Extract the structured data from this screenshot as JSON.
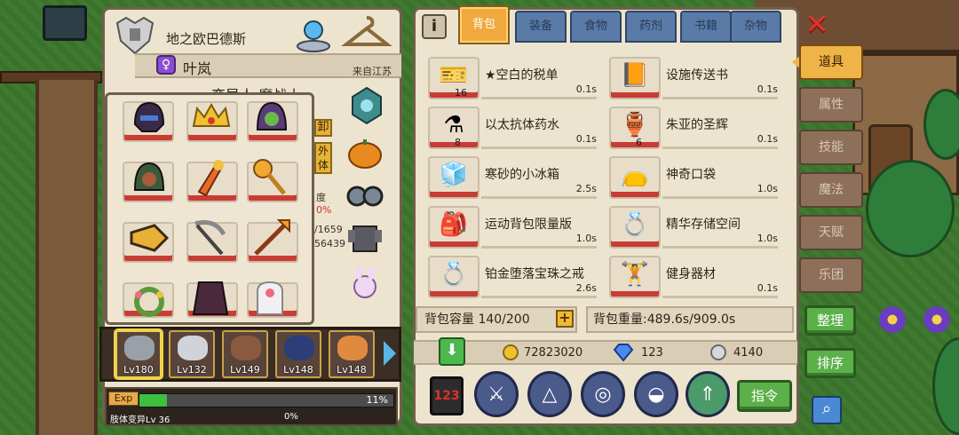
{
  "character": {
    "name": "地之欧巴德斯",
    "player_name": "叶岚",
    "origin": "来自江苏",
    "race": "变异人 魔战士",
    "side_values": [
      "度",
      "0%",
      "/1659",
      "56439"
    ],
    "side_buttons": [
      "卸",
      "外\n体"
    ]
  },
  "heroes": [
    {
      "level": "Lv180",
      "color": "#9aa0a8"
    },
    {
      "level": "Lv132",
      "color": "#d0d4da"
    },
    {
      "level": "Lv149",
      "color": "#8a5a40"
    },
    {
      "level": "Lv148",
      "color": "#2c3e78"
    },
    {
      "level": "Lv148",
      "color": "#e08a40"
    }
  ],
  "exp": {
    "label": "Exp",
    "percent_text": "11%",
    "percent": 11,
    "sub_label": "肢体变异Lv 36",
    "sub_percent_text": "0%"
  },
  "tabs": [
    "背包",
    "装备",
    "食物",
    "药剂",
    "书籍",
    "杂物"
  ],
  "active_tab": 0,
  "items": [
    {
      "name": "★空白的税单",
      "weight": "0.1s",
      "qty": "16",
      "icon": "ticket-icon",
      "glyph": "🎫"
    },
    {
      "name": "设施传送书",
      "weight": "0.1s",
      "qty": "",
      "icon": "book-icon",
      "glyph": "📙"
    },
    {
      "name": "以太抗体药水",
      "weight": "0.1s",
      "qty": "8",
      "icon": "potion-icon",
      "glyph": "⚗"
    },
    {
      "name": "朱亚的圣辉",
      "weight": "0.1s",
      "qty": "6",
      "icon": "holy-flask-icon",
      "glyph": "🏺"
    },
    {
      "name": "寒砂的小冰箱",
      "weight": "2.5s",
      "qty": "",
      "icon": "ice-box-icon",
      "glyph": "🧊"
    },
    {
      "name": "神奇口袋",
      "weight": "1.0s",
      "qty": "",
      "icon": "pouch-icon",
      "glyph": "👝"
    },
    {
      "name": "运动背包限量版",
      "weight": "1.0s",
      "qty": "",
      "icon": "backpack-icon",
      "glyph": "🎒"
    },
    {
      "name": "精华存储空间",
      "weight": "1.0s",
      "qty": "",
      "icon": "ring-icon",
      "glyph": "💍"
    },
    {
      "name": "铂金堕落宝珠之戒",
      "weight": "2.6s",
      "qty": "",
      "icon": "ring-icon",
      "glyph": "💍"
    },
    {
      "name": "健身器材",
      "weight": "0.1s",
      "qty": "",
      "icon": "dumbbell-icon",
      "glyph": "🏋"
    }
  ],
  "capacity": {
    "label": "背包容量 140/200",
    "plus": "+"
  },
  "weight_total": "背包重量:489.6s/909.0s",
  "currency": {
    "gold": "72823020",
    "diamond": "123",
    "silver": "4140"
  },
  "command_button": "指令",
  "categories": [
    "道具",
    "属性",
    "技能",
    "魔法",
    "天赋",
    "乐团"
  ],
  "active_category": 0,
  "organize_button": "整理",
  "sort_button": "排序",
  "colors": {
    "accent": "#efb448",
    "slot_red": "#c93c34",
    "tab_blue": "#5a7ba8",
    "panel": "#ede4cf"
  }
}
